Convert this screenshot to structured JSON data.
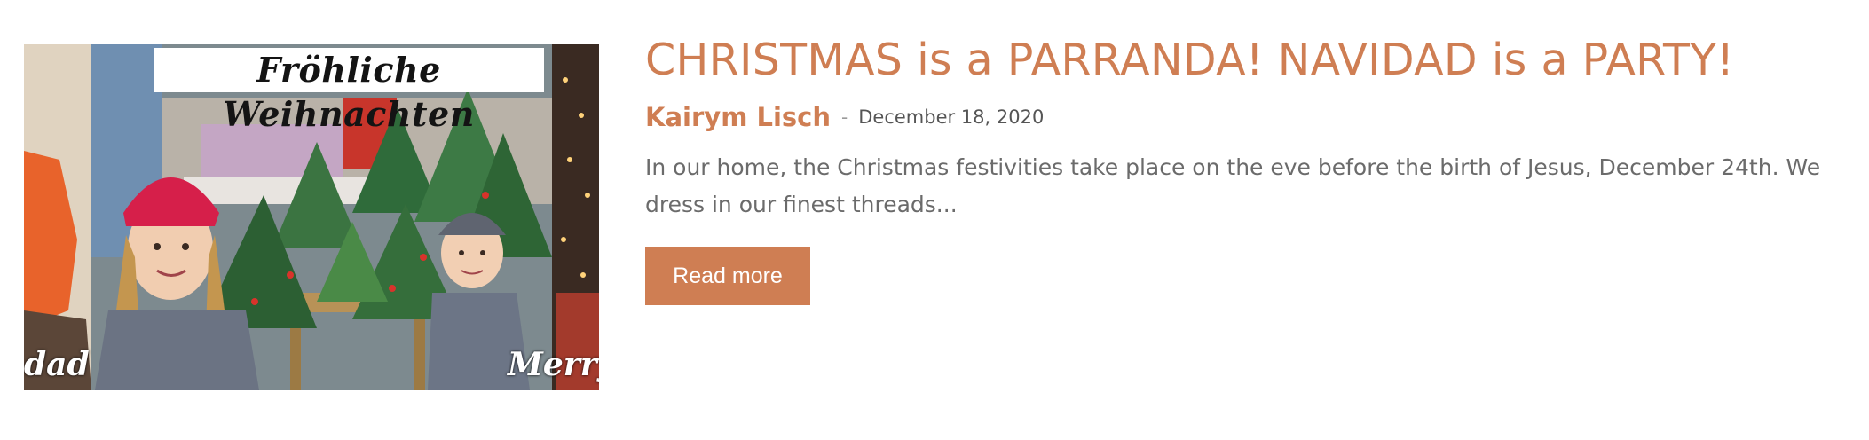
{
  "post": {
    "title": "CHRISTMAS is a PARRANDA! NAVIDAD is a PARTY!",
    "author": "Kairym Lisch",
    "separator": "-",
    "date": "December 18, 2020",
    "excerpt": "In our home, the Christmas festivities take place on the eve before the birth of Jesus, December 24th. We dress in our finest threads...",
    "read_more_label": "Read more"
  },
  "thumbnail": {
    "caption_top": "Fröhliche Weihnachten",
    "caption_left": "dad",
    "caption_right": "Merry"
  },
  "colors": {
    "accent": "#cf7e53",
    "text_muted": "#6b6b6b",
    "date_text": "#555555",
    "button_text": "#ffffff"
  }
}
